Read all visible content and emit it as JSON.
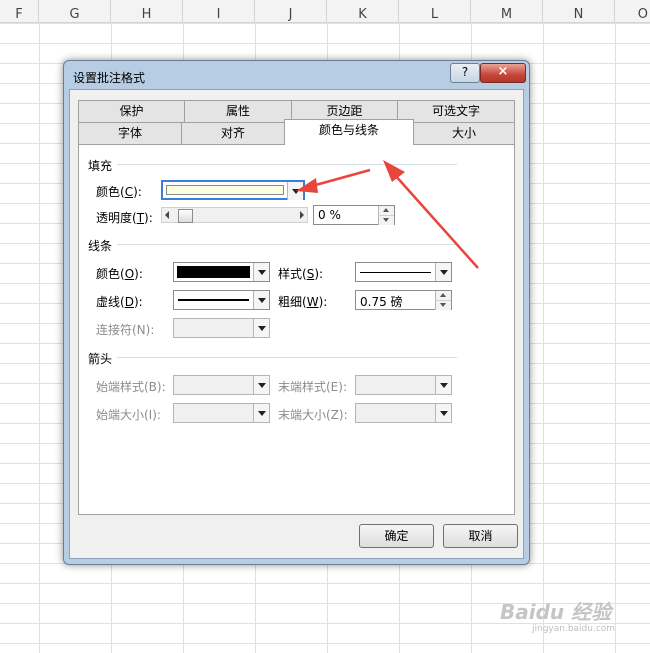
{
  "sheet": {
    "columns": [
      "F",
      "G",
      "H",
      "I",
      "J",
      "K",
      "L",
      "M",
      "N",
      "O"
    ]
  },
  "dialog": {
    "title": "设置批注格式",
    "help_label": "?",
    "close_label": "×",
    "tabs_row1": [
      "保护",
      "属性",
      "页边距",
      "可选文字"
    ],
    "tabs_row2": [
      "字体",
      "对齐",
      "颜色与线条",
      "大小"
    ],
    "active_tab": "颜色与线条",
    "fill": {
      "group_label": "填充",
      "color_label": "颜色(",
      "color_key": "C",
      "color_label_end": "):",
      "color_value": "#fdfde0",
      "transparency_label": "透明度(",
      "transparency_key": "T",
      "transparency_label_end": "):",
      "transparency_value": "0 %",
      "transparency_level": 0
    },
    "line": {
      "group_label": "线条",
      "color_label": "颜色(",
      "color_key": "O",
      "color_label_end": "):",
      "color_value": "#000000",
      "style_label": "样式(",
      "style_key": "S",
      "style_label_end": "):",
      "dash_label": "虚线(",
      "dash_key": "D",
      "dash_label_end": "):",
      "weight_label": "粗细(",
      "weight_key": "W",
      "weight_label_end": "):",
      "weight_value": "0.75 磅",
      "connector_label": "连接符(N):"
    },
    "arrows": {
      "group_label": "箭头",
      "begin_style_label": "始端样式(B):",
      "end_style_label": "末端样式(E):",
      "begin_size_label": "始端大小(I):",
      "end_size_label": "末端大小(Z):"
    },
    "ok_label": "确定",
    "cancel_label": "取消"
  },
  "annotation": {
    "arrow_color": "#e8453c"
  },
  "watermark": {
    "logo": "Baidu 经验",
    "url": "jingyan.baidu.com"
  }
}
